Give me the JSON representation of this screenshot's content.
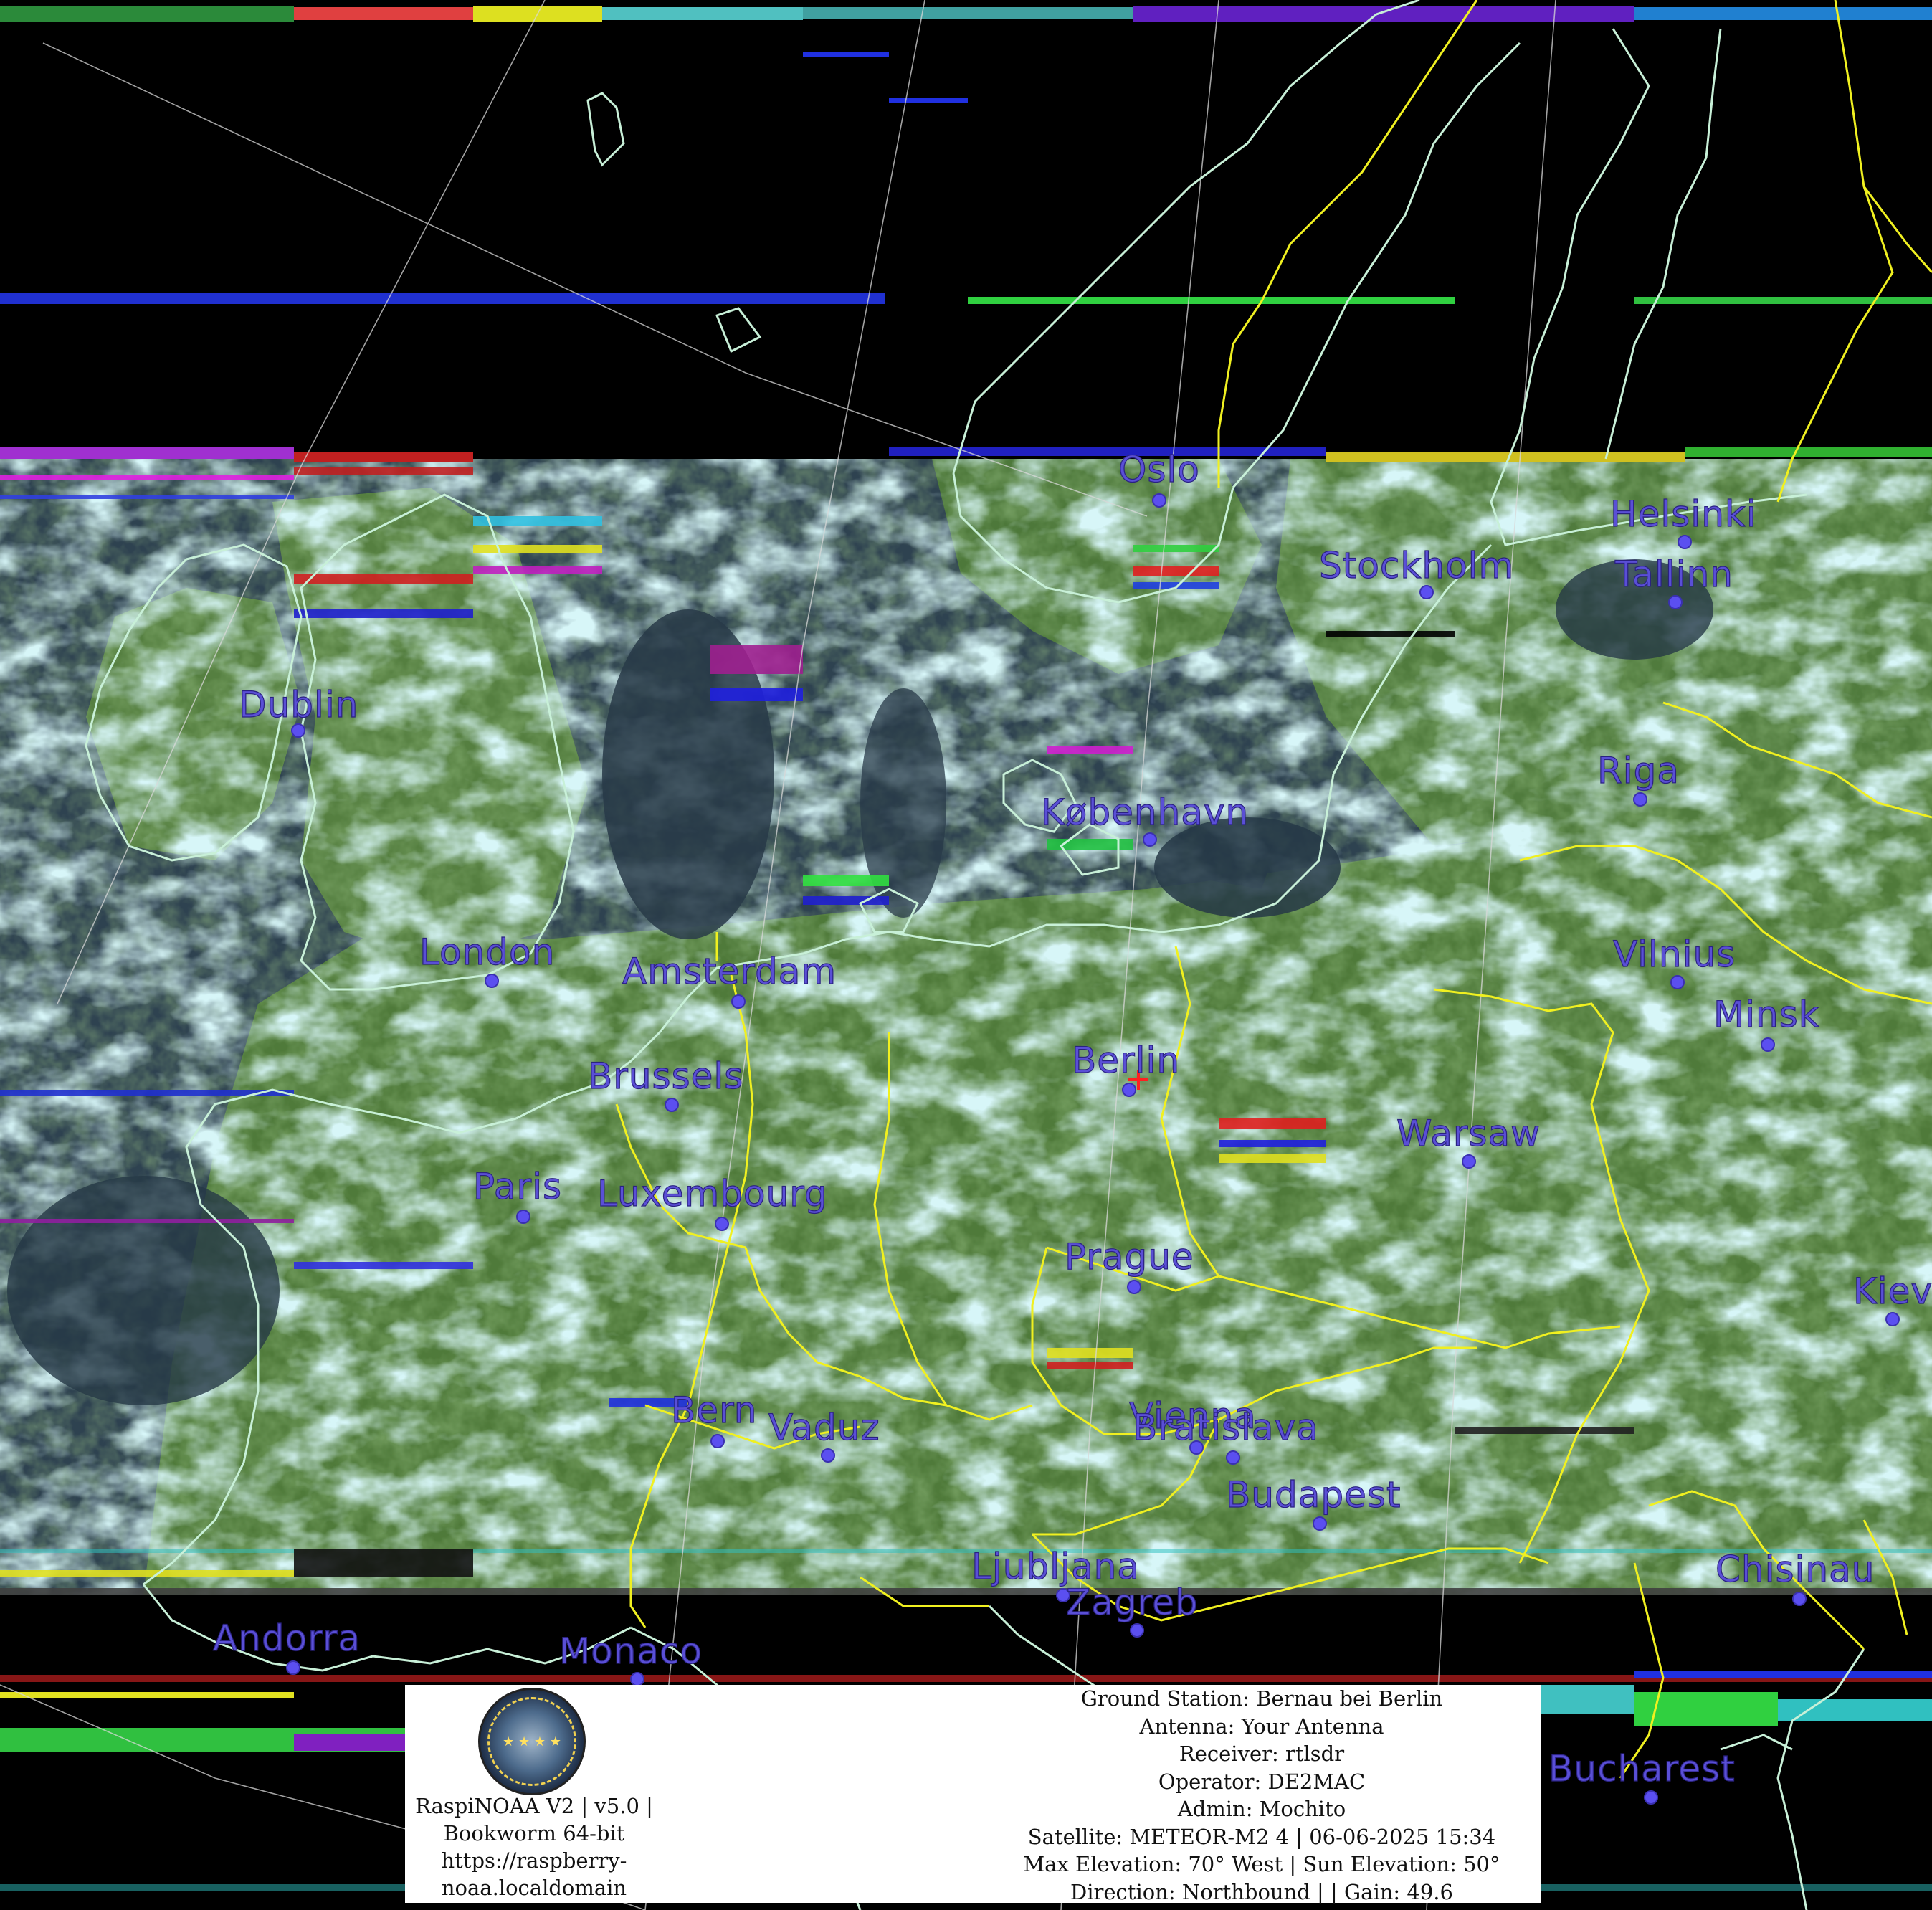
{
  "cities": [
    {
      "name": "Oslo"
    },
    {
      "name": "Stockholm"
    },
    {
      "name": "Helsinki"
    },
    {
      "name": "Tallinn"
    },
    {
      "name": "Dublin"
    },
    {
      "name": "Riga"
    },
    {
      "name": "København"
    },
    {
      "name": "Vilnius"
    },
    {
      "name": "London"
    },
    {
      "name": "Amsterdam"
    },
    {
      "name": "Minsk"
    },
    {
      "name": "Berlin"
    },
    {
      "name": "Brussels"
    },
    {
      "name": "Warsaw"
    },
    {
      "name": "Paris"
    },
    {
      "name": "Luxembourg"
    },
    {
      "name": "Prague"
    },
    {
      "name": "Kiev"
    },
    {
      "name": "Bern"
    },
    {
      "name": "Vaduz"
    },
    {
      "name": "Vienna"
    },
    {
      "name": "Bratislava"
    },
    {
      "name": "Budapest"
    },
    {
      "name": "Ljubljana"
    },
    {
      "name": "Zagreb"
    },
    {
      "name": "Chisinau"
    },
    {
      "name": "Andorra"
    },
    {
      "name": "Monaco"
    },
    {
      "name": "Bucharest"
    }
  ],
  "colors": {
    "coastline": "#c8f0d8",
    "border": "#f0f020",
    "label": "#5a4fd6",
    "cloud": "#a8e4ea",
    "land": "#5a8a3c",
    "sea": "#243848",
    "station_marker": "#ff2020"
  },
  "footer": {
    "logo_icon": "raspinoaa-logo-icon",
    "left_lines": [
      "RaspiNOAA V2 | v5.0 |",
      "Bookworm 64-bit",
      "https://raspberry-",
      "noaa.localdomain"
    ],
    "right_lines": [
      "Ground Station: Bernau bei Berlin",
      "Antenna: Your Antenna",
      "Receiver: rtlsdr",
      "Operator: DE2MAC",
      "Admin: Mochito",
      "Satellite: METEOR-M2 4 | 06-06-2025 15:34",
      "Max Elevation: 70° West | Sun Elevation: 50°",
      "Direction: Northbound | | Gain: 49.6"
    ]
  }
}
